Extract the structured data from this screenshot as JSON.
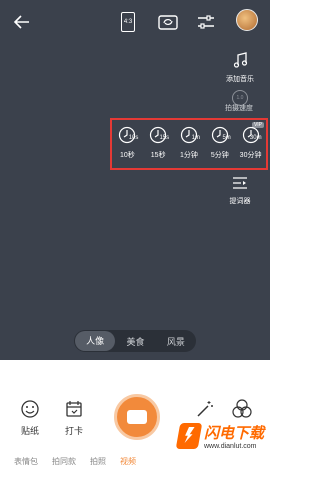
{
  "topbar": {
    "ratio_label": "4:3"
  },
  "side": {
    "add_music_label": "添加音乐",
    "speed_badge": "1.0",
    "speed_label": "拍摄速度",
    "prompter_label": "提词器"
  },
  "timers": [
    {
      "value": "10s",
      "label": "10秒"
    },
    {
      "value": "15s",
      "label": "15秒"
    },
    {
      "value": "1m",
      "label": "1分钟"
    },
    {
      "value": "5m",
      "label": "5分钟"
    },
    {
      "value": "30m",
      "label": "30分钟"
    }
  ],
  "vip_badge": "VIP",
  "modes": [
    {
      "label": "人像",
      "active": true
    },
    {
      "label": "美食",
      "active": false
    },
    {
      "label": "风景",
      "active": false
    }
  ],
  "bottom": {
    "tools": [
      {
        "label": "贴纸"
      },
      {
        "label": "打卡"
      }
    ],
    "tabs": [
      {
        "label": "表情包",
        "active": false
      },
      {
        "label": "拍同款",
        "active": false
      },
      {
        "label": "拍照",
        "active": false
      },
      {
        "label": "视频",
        "active": true
      }
    ]
  },
  "watermark": {
    "title": "闪电下载",
    "url": "www.dianlut.com"
  },
  "colors": {
    "viewfinder": "#3b414c",
    "accent": "#f28a3b",
    "highlight": "#e53935"
  }
}
